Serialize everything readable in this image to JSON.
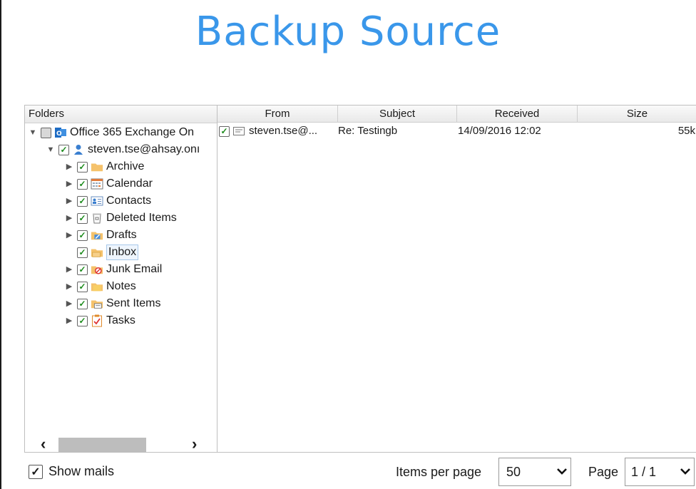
{
  "title": "Backup Source",
  "folders": {
    "header": "Folders",
    "root": {
      "label": "Office 365 Exchange On"
    },
    "account": {
      "label": "steven.tse@ahsay.onı"
    },
    "items": [
      {
        "label": "Archive",
        "icon": "folder-icon"
      },
      {
        "label": "Calendar",
        "icon": "calendar-icon"
      },
      {
        "label": "Contacts",
        "icon": "contacts-icon"
      },
      {
        "label": "Deleted Items",
        "icon": "trash-icon"
      },
      {
        "label": "Drafts",
        "icon": "drafts-icon"
      },
      {
        "label": "Inbox",
        "icon": "inbox-icon"
      },
      {
        "label": "Junk Email",
        "icon": "junk-icon"
      },
      {
        "label": "Notes",
        "icon": "notes-icon"
      },
      {
        "label": "Sent Items",
        "icon": "sent-icon"
      },
      {
        "label": "Tasks",
        "icon": "tasks-icon"
      }
    ]
  },
  "mails": {
    "columns": [
      "From",
      "Subject",
      "Received",
      "Size"
    ],
    "rows": [
      {
        "from": "steven.tse@...",
        "subject": "Re: Testingb",
        "received": "14/09/2016 12:02",
        "size": "55k"
      }
    ]
  },
  "footer": {
    "show_mails_label": "Show mails",
    "items_per_page_label": "Items per page",
    "items_per_page_value": "50",
    "page_label": "Page",
    "page_value": "1 / 1"
  },
  "colors": {
    "title": "#3a97ea",
    "check": "#1a8a1a"
  }
}
